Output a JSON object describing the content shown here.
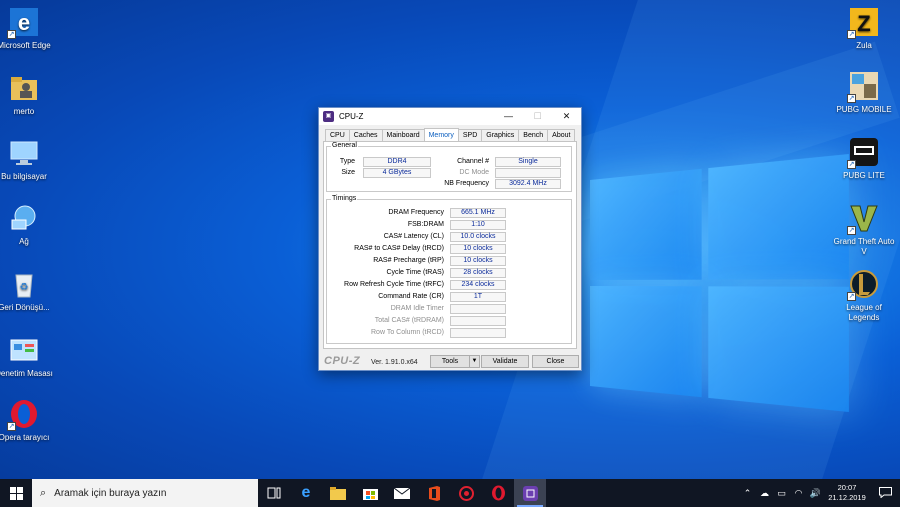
{
  "desktop": {
    "left_icons": [
      {
        "label": "Microsoft Edge",
        "icon": "edge-icon"
      },
      {
        "label": "merto",
        "icon": "user-folder-icon"
      },
      {
        "label": "Bu bilgisayar",
        "icon": "computer-icon"
      },
      {
        "label": "Ağ",
        "icon": "network-icon"
      },
      {
        "label": "Geri Dönüşü...",
        "icon": "recycle-bin-icon"
      },
      {
        "label": "Denetim Masası",
        "icon": "control-panel-icon"
      },
      {
        "label": "Opera tarayıcı",
        "icon": "opera-icon"
      }
    ],
    "right_icons": [
      {
        "label": "Zula",
        "icon": "zula-icon"
      },
      {
        "label": "PUBG MOBILE",
        "icon": "pubg-mobile-icon"
      },
      {
        "label": "PUBG LITE",
        "icon": "pubg-lite-icon"
      },
      {
        "label": "Grand Theft Auto V",
        "icon": "gta-v-icon"
      },
      {
        "label": "League of Legends",
        "icon": "league-of-legends-icon"
      }
    ]
  },
  "window": {
    "title": "CPU-Z",
    "tabs": [
      "CPU",
      "Caches",
      "Mainboard",
      "Memory",
      "SPD",
      "Graphics",
      "Bench",
      "About"
    ],
    "active_tab": "Memory",
    "general": {
      "legend": "General",
      "type_label": "Type",
      "type_value": "DDR4",
      "size_label": "Size",
      "size_value": "4 GBytes",
      "channel_label": "Channel #",
      "channel_value": "Single",
      "dcmode_label": "DC Mode",
      "dcmode_value": "",
      "nbfreq_label": "NB Frequency",
      "nbfreq_value": "3092.4 MHz"
    },
    "timings": {
      "legend": "Timings",
      "rows": [
        {
          "label": "DRAM Frequency",
          "value": "665.1 MHz",
          "dim": false
        },
        {
          "label": "FSB:DRAM",
          "value": "1:10",
          "dim": false
        },
        {
          "label": "CAS# Latency (CL)",
          "value": "10.0 clocks",
          "dim": false
        },
        {
          "label": "RAS# to CAS# Delay (tRCD)",
          "value": "10 clocks",
          "dim": false
        },
        {
          "label": "RAS# Precharge (tRP)",
          "value": "10 clocks",
          "dim": false
        },
        {
          "label": "Cycle Time (tRAS)",
          "value": "28 clocks",
          "dim": false
        },
        {
          "label": "Row Refresh Cycle Time (tRFC)",
          "value": "234 clocks",
          "dim": false
        },
        {
          "label": "Command Rate (CR)",
          "value": "1T",
          "dim": false
        },
        {
          "label": "DRAM Idle Timer",
          "value": "",
          "dim": true
        },
        {
          "label": "Total CAS# (tRDRAM)",
          "value": "",
          "dim": true
        },
        {
          "label": "Row To Column (tRCD)",
          "value": "",
          "dim": true
        }
      ]
    },
    "footer": {
      "brand": "CPU-Z",
      "version": "Ver. 1.91.0.x64",
      "tools_label": "Tools",
      "validate_label": "Validate",
      "close_label": "Close"
    }
  },
  "taskbar": {
    "search_placeholder": "Aramak için buraya yazın",
    "pinned": [
      "task-view-icon",
      "edge-icon",
      "file-explorer-icon",
      "store-icon",
      "mail-icon",
      "office-icon",
      "app-icon",
      "opera-icon",
      "cpuz-icon"
    ],
    "time": "20:07",
    "date": "21.12.2019"
  },
  "colors": {
    "accent": "#0c5fbf",
    "value_text": "#0a2a9a",
    "taskbar": "#101623"
  }
}
